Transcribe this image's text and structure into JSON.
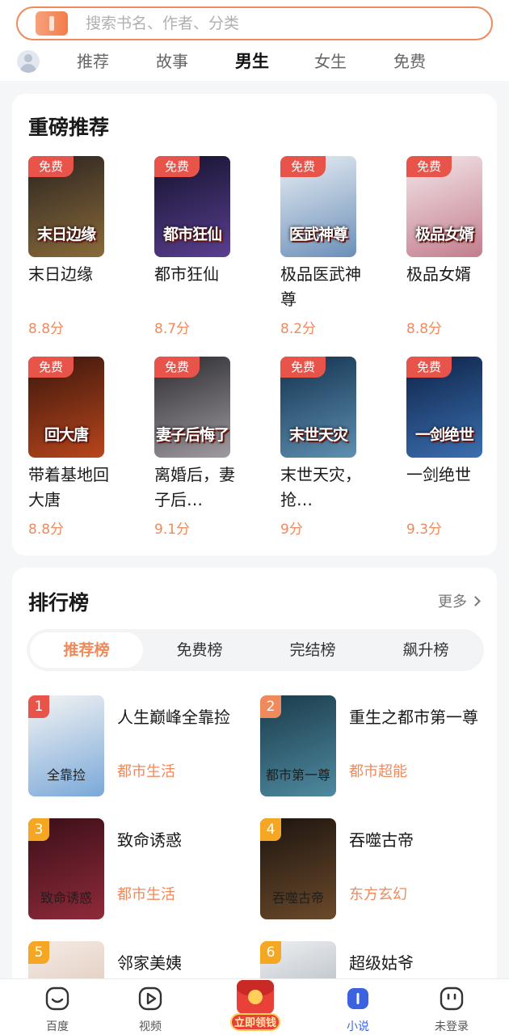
{
  "search": {
    "placeholder": "搜索书名、作者、分类"
  },
  "tabs": [
    {
      "label": "推荐",
      "active": false
    },
    {
      "label": "故事",
      "active": false
    },
    {
      "label": "男生",
      "active": true
    },
    {
      "label": "女生",
      "active": false
    },
    {
      "label": "免费",
      "active": false
    }
  ],
  "featured": {
    "title": "重磅推荐",
    "free_badge": "免费",
    "books": [
      {
        "title": "末日边缘",
        "score": "8.8分",
        "cover_text": "末日边缘",
        "cover_colors": [
          "#2b2420",
          "#8a6a3a"
        ]
      },
      {
        "title": "都市狂仙",
        "score": "8.7分",
        "cover_text": "都市狂仙",
        "cover_colors": [
          "#14122e",
          "#5a3f8f"
        ]
      },
      {
        "title": "极品医武神尊",
        "score": "8.2分",
        "cover_text": "医武神尊",
        "cover_colors": [
          "#e8eef5",
          "#6b8fb8"
        ]
      },
      {
        "title": "极品女婿",
        "score": "8.8分",
        "cover_text": "极品女婿",
        "cover_colors": [
          "#f4e6ea",
          "#c27d8c"
        ]
      },
      {
        "title": "带着基地回大唐",
        "score": "8.8分",
        "cover_text": "回大唐",
        "cover_colors": [
          "#3a160c",
          "#b8461c"
        ]
      },
      {
        "title": "离婚后，妻子后…",
        "score": "9.1分",
        "cover_text": "妻子后悔了",
        "cover_colors": [
          "#2b2b30",
          "#a09ba0"
        ]
      },
      {
        "title": "末世天灾，抢…",
        "score": "9分",
        "cover_text": "末世天灾",
        "cover_colors": [
          "#12324f",
          "#5f8fb0"
        ]
      },
      {
        "title": "一剑绝世",
        "score": "9.3分",
        "cover_text": "一剑绝世",
        "cover_colors": [
          "#0d2247",
          "#3b6fb0"
        ]
      }
    ]
  },
  "ranking": {
    "title": "排行榜",
    "more_label": "更多",
    "tabs": [
      {
        "label": "推荐榜",
        "active": true
      },
      {
        "label": "免费榜",
        "active": false
      },
      {
        "label": "完结榜",
        "active": false
      },
      {
        "label": "飙升榜",
        "active": false
      }
    ],
    "items": [
      {
        "rank": "1",
        "title": "人生巅峰全靠捡",
        "category": "都市生活",
        "cover_text": "全靠捡",
        "rank_color": "#e8534a",
        "cover_colors": [
          "#f4f4f4",
          "#7aa8d8"
        ]
      },
      {
        "rank": "2",
        "title": "重生之都市第一尊",
        "category": "都市超能",
        "cover_text": "都市第一尊",
        "rank_color": "#f08a5d",
        "cover_colors": [
          "#1a3b4a",
          "#4f8aa0"
        ]
      },
      {
        "rank": "3",
        "title": "致命诱惑",
        "category": "都市生活",
        "cover_text": "致命诱惑",
        "rank_color": "#f5a623",
        "cover_colors": [
          "#3a0f18",
          "#8f2a3a"
        ]
      },
      {
        "rank": "4",
        "title": "吞噬古帝",
        "category": "东方玄幻",
        "cover_text": "吞噬古帝",
        "rank_color": "#f5a623",
        "cover_colors": [
          "#1c1410",
          "#6b4a2a"
        ]
      },
      {
        "rank": "5",
        "title": "邻家美姨",
        "category": "",
        "cover_text": "",
        "rank_color": "#f5a623",
        "cover_colors": [
          "#f4ece6",
          "#d8b8a8"
        ]
      },
      {
        "rank": "6",
        "title": "超级姑爷",
        "category": "",
        "cover_text": "",
        "rank_color": "#f5a623",
        "cover_colors": [
          "#eef0f2",
          "#9aa4ae"
        ]
      }
    ]
  },
  "bottom_nav": [
    {
      "label": "百度",
      "icon": "baidu-icon",
      "active": false
    },
    {
      "label": "视频",
      "icon": "video-icon",
      "active": false
    },
    {
      "label": "小说",
      "icon": "novel-icon",
      "active": true
    },
    {
      "label": "未登录",
      "icon": "user-icon",
      "active": false
    }
  ],
  "redpack": {
    "label": "立即领钱",
    "icon": "red-packet-icon"
  },
  "colors": {
    "accent": "#f08a5d",
    "free_badge": "#e8534a",
    "nav_active": "#3b63e0"
  }
}
